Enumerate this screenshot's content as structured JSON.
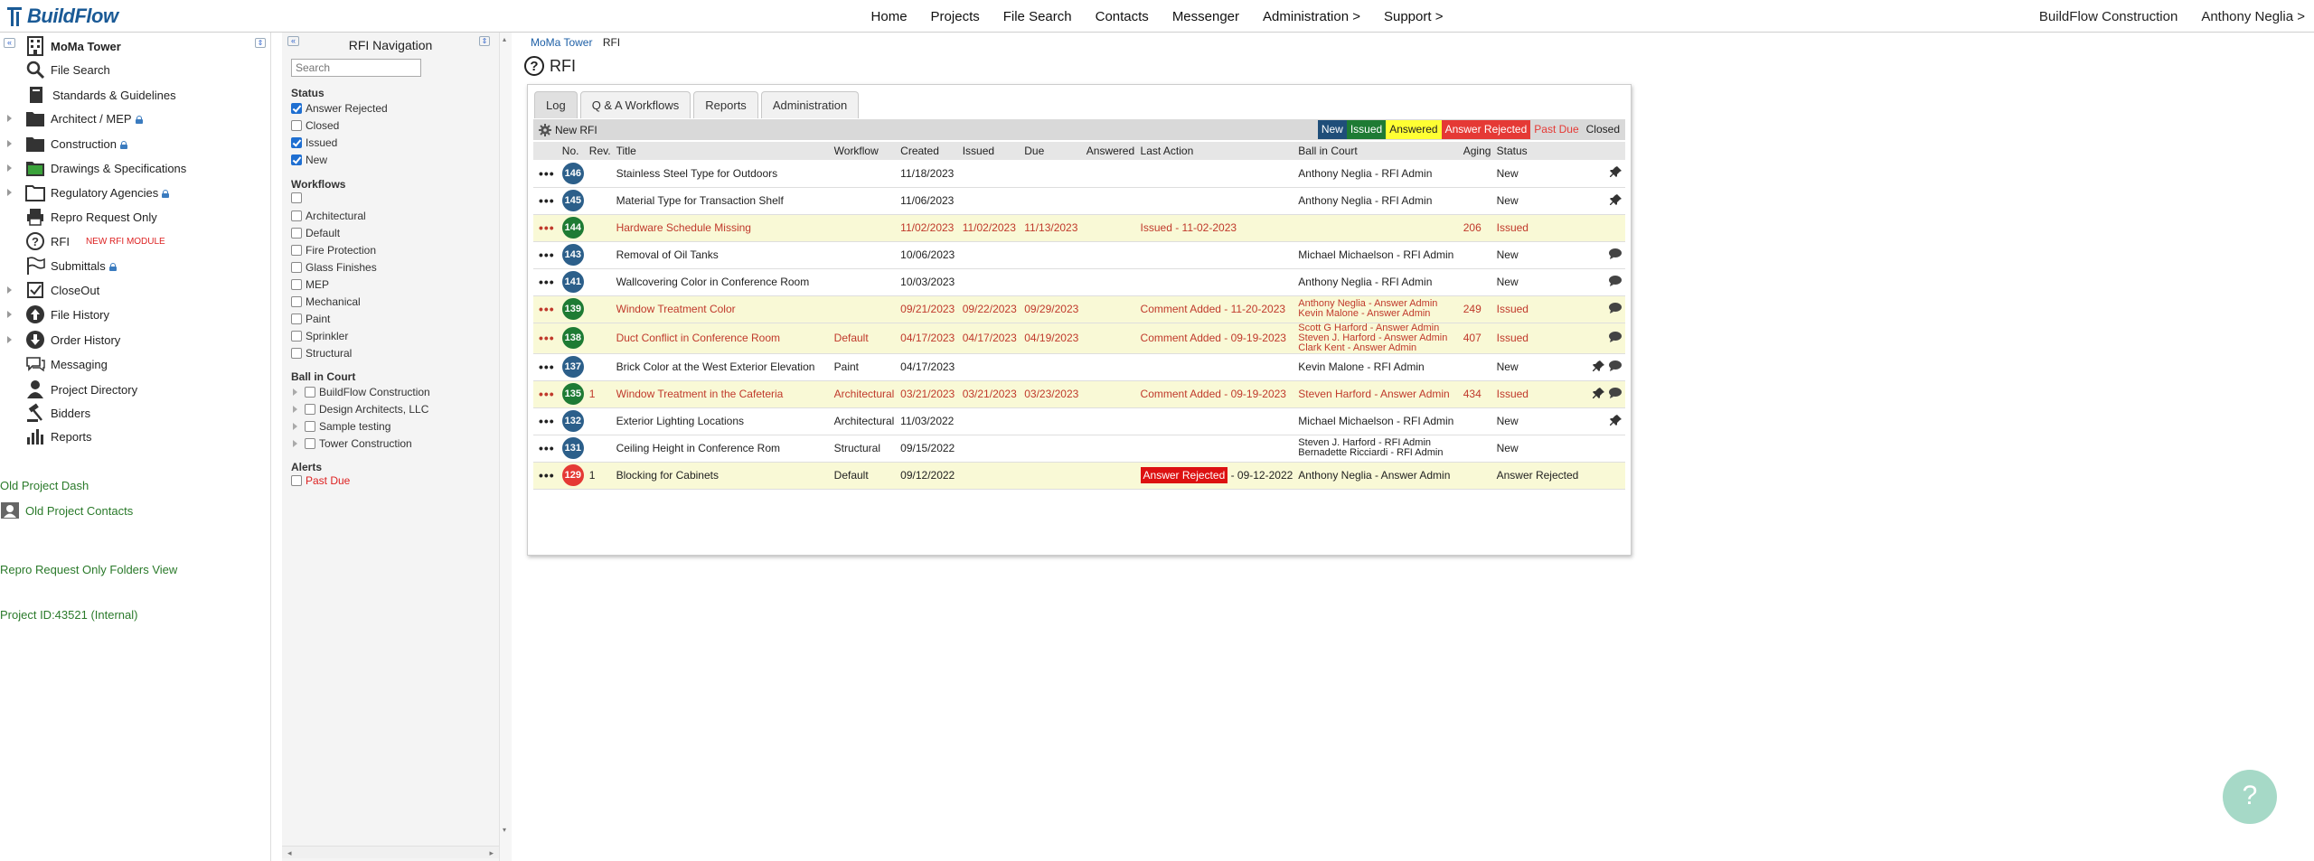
{
  "header": {
    "logo_text": "BuildFlow",
    "nav": [
      "Home",
      "Projects",
      "File Search",
      "Contacts",
      "Messenger",
      "Administration >",
      "Support >"
    ],
    "company": "BuildFlow Construction",
    "user": "Anthony Neglia >"
  },
  "project_tree": {
    "project_name": "MoMa Tower",
    "items": [
      {
        "label": "File Search",
        "icon": "magnifier-icon"
      },
      {
        "label": "Standards & Guidelines",
        "icon": "book-icon"
      },
      {
        "label": "Architect / MEP",
        "icon": "folder-icon",
        "locked": true,
        "expandable": true
      },
      {
        "label": "Construction",
        "icon": "folder-icon",
        "locked": true,
        "expandable": true
      },
      {
        "label": "Drawings & Specifications",
        "icon": "green-folder-icon",
        "expandable": true
      },
      {
        "label": "Regulatory Agencies",
        "icon": "folder-outline-icon",
        "locked": true,
        "expandable": true
      },
      {
        "label": "Repro Request Only",
        "icon": "printer-icon"
      },
      {
        "label": "RFI",
        "icon": "question-circle-icon",
        "note": "NEW RFI MODULE"
      },
      {
        "label": "Submittals",
        "icon": "flag-icon",
        "locked": true
      },
      {
        "label": "CloseOut",
        "icon": "checkbox-icon",
        "expandable": true
      },
      {
        "label": "File History",
        "icon": "upload-circle-icon",
        "expandable": true
      },
      {
        "label": "Order History",
        "icon": "download-circle-icon",
        "expandable": true
      },
      {
        "label": "Messaging",
        "icon": "chat-icon"
      },
      {
        "label": "Project Directory",
        "icon": "person-icon"
      },
      {
        "label": "Bidders",
        "icon": "hammer-icon"
      },
      {
        "label": "Reports",
        "icon": "bar-chart-icon"
      }
    ],
    "old_dash": "Old Project Dash",
    "old_contacts": "Old Project Contacts",
    "repro_view": "Repro Request Only Folders View",
    "project_id": "Project ID:43521 (Internal)"
  },
  "rfi_nav": {
    "title": "RFI Navigation",
    "search_placeholder": "Search",
    "status_head": "Status",
    "status": [
      {
        "label": "Answer Rejected",
        "checked": true
      },
      {
        "label": "Closed",
        "checked": false
      },
      {
        "label": "Issued",
        "checked": true
      },
      {
        "label": "New",
        "checked": true
      }
    ],
    "workflows_head": "Workflows",
    "workflows": [
      "",
      "Architectural",
      "Default",
      "Fire Protection",
      "Glass Finishes",
      "MEP",
      "Mechanical",
      "Paint",
      "Sprinkler",
      "Structural"
    ],
    "ball_head": "Ball in Court",
    "ball": [
      "BuildFlow Construction",
      "Design Architects, LLC",
      "Sample testing",
      "Tower Construction"
    ],
    "alerts_head": "Alerts",
    "alert_item": "Past Due"
  },
  "main": {
    "breadcrumb": [
      "MoMa Tower",
      "RFI"
    ],
    "title": "RFI",
    "tabs": [
      "Log",
      "Q & A Workflows",
      "Reports",
      "Administration"
    ],
    "new_rfi": "New RFI",
    "legend": [
      {
        "label": "New",
        "bg": "#1f4e79",
        "fg": "#ffffff"
      },
      {
        "label": "Issued",
        "bg": "#1e7b34",
        "fg": "#ffffff"
      },
      {
        "label": "Answered",
        "bg": "#ffff33",
        "fg": "#222222"
      },
      {
        "label": "Answer Rejected",
        "bg": "#e53935",
        "fg": "#ffffff"
      },
      {
        "label": "Past Due",
        "bg": "#d9d9d9",
        "fg": "#e53935"
      },
      {
        "label": "Closed",
        "bg": "#d9d9d9",
        "fg": "#222222"
      }
    ],
    "columns": [
      "",
      "No.",
      "Rev.",
      "Title",
      "Workflow",
      "Created",
      "Issued",
      "Due",
      "Answered",
      "Last Action",
      "Ball in Court",
      "Aging",
      "Status",
      ""
    ],
    "rows": [
      {
        "no": "146",
        "badge": "#2c5f8a",
        "rev": "",
        "title": "Stainless Steel Type for Outdoors",
        "workflow": "",
        "created": "11/18/2023",
        "issued": "",
        "due": "",
        "answered": "",
        "last_action": "",
        "ball": [
          "Anthony Neglia - RFI Admin"
        ],
        "aging": "",
        "status": "New",
        "pin": true,
        "chat": false,
        "alt": false,
        "red": false
      },
      {
        "no": "145",
        "badge": "#2c5f8a",
        "rev": "",
        "title": "Material Type for Transaction Shelf",
        "workflow": "",
        "created": "11/06/2023",
        "issued": "",
        "due": "",
        "answered": "",
        "last_action": "",
        "ball": [
          "Anthony Neglia - RFI Admin"
        ],
        "aging": "",
        "status": "New",
        "pin": true,
        "chat": false,
        "alt": false,
        "red": false
      },
      {
        "no": "144",
        "badge": "#1e7b34",
        "rev": "",
        "title": "Hardware Schedule Missing",
        "workflow": "",
        "created": "11/02/2023",
        "issued": "11/02/2023",
        "due": "11/13/2023",
        "answered": "",
        "last_action": "Issued - 11-02-2023",
        "ball": [
          ""
        ],
        "aging": "206",
        "status": "Issued",
        "pin": false,
        "chat": false,
        "alt": true,
        "red": true
      },
      {
        "no": "143",
        "badge": "#2c5f8a",
        "rev": "",
        "title": "Removal of Oil Tanks",
        "workflow": "",
        "created": "10/06/2023",
        "issued": "",
        "due": "",
        "answered": "",
        "last_action": "",
        "ball": [
          "Michael Michaelson - RFI Admin"
        ],
        "aging": "",
        "status": "New",
        "pin": false,
        "chat": true,
        "alt": false,
        "red": false
      },
      {
        "no": "141",
        "badge": "#2c5f8a",
        "rev": "",
        "title": "Wallcovering Color in Conference Room",
        "workflow": "",
        "created": "10/03/2023",
        "issued": "",
        "due": "",
        "answered": "",
        "last_action": "",
        "ball": [
          "Anthony Neglia - RFI Admin"
        ],
        "aging": "",
        "status": "New",
        "pin": false,
        "chat": true,
        "alt": false,
        "red": false
      },
      {
        "no": "139",
        "badge": "#1e7b34",
        "rev": "",
        "title": "Window Treatment Color",
        "workflow": "",
        "created": "09/21/2023",
        "issued": "09/22/2023",
        "due": "09/29/2023",
        "answered": "",
        "last_action": "Comment Added - 11-20-2023",
        "ball": [
          "Anthony Neglia - Answer Admin",
          "Kevin Malone - Answer Admin"
        ],
        "aging": "249",
        "status": "Issued",
        "pin": false,
        "chat": true,
        "alt": true,
        "red": true
      },
      {
        "no": "138",
        "badge": "#1e7b34",
        "rev": "",
        "title": "Duct Conflict in Conference Room",
        "workflow": "Default",
        "created": "04/17/2023",
        "issued": "04/17/2023",
        "due": "04/19/2023",
        "answered": "",
        "last_action": "Comment Added - 09-19-2023",
        "ball": [
          "Scott G Harford - Answer Admin",
          "Steven J. Harford - Answer Admin",
          "Clark Kent - Answer Admin"
        ],
        "aging": "407",
        "status": "Issued",
        "pin": false,
        "chat": true,
        "alt": true,
        "red": true
      },
      {
        "no": "137",
        "badge": "#2c5f8a",
        "rev": "",
        "title": "Brick Color at the West Exterior Elevation",
        "workflow": "Paint",
        "created": "04/17/2023",
        "issued": "",
        "due": "",
        "answered": "",
        "last_action": "",
        "ball": [
          "Kevin Malone - RFI Admin"
        ],
        "aging": "",
        "status": "New",
        "pin": true,
        "chat": true,
        "alt": false,
        "red": false
      },
      {
        "no": "135",
        "badge": "#1e7b34",
        "rev": "1",
        "title": "Window Treatment in the Cafeteria",
        "workflow": "Architectural",
        "created": "03/21/2023",
        "issued": "03/21/2023",
        "due": "03/23/2023",
        "answered": "",
        "last_action": "Comment Added - 09-19-2023",
        "ball": [
          "Steven Harford - Answer Admin"
        ],
        "aging": "434",
        "status": "Issued",
        "pin": true,
        "chat": true,
        "alt": true,
        "red": true
      },
      {
        "no": "132",
        "badge": "#2c5f8a",
        "rev": "",
        "title": "Exterior Lighting Locations",
        "workflow": "Architectural",
        "created": "11/03/2022",
        "issued": "",
        "due": "",
        "answered": "",
        "last_action": "",
        "ball": [
          "Michael Michaelson - RFI Admin"
        ],
        "aging": "",
        "status": "New",
        "pin": true,
        "chat": false,
        "alt": false,
        "red": false
      },
      {
        "no": "131",
        "badge": "#2c5f8a",
        "rev": "",
        "title": "Ceiling Height in Conference Rom",
        "workflow": "Structural",
        "created": "09/15/2022",
        "issued": "",
        "due": "",
        "answered": "",
        "last_action": "",
        "ball": [
          "Steven J. Harford - RFI Admin",
          "Bernadette Ricciardi - RFI Admin"
        ],
        "aging": "",
        "status": "New",
        "pin": false,
        "chat": false,
        "alt": false,
        "red": false
      },
      {
        "no": "129",
        "badge": "#e53935",
        "rev": "1",
        "title": "Blocking for Cabinets",
        "workflow": "Default",
        "created": "09/12/2022",
        "issued": "",
        "due": "",
        "answered": "",
        "last_action": "",
        "last_action_badge": "Answer Rejected",
        "last_action_date": " - 09-12-2022",
        "ball": [
          "Anthony Neglia - Answer Admin"
        ],
        "aging": "",
        "status": "Answer Rejected",
        "pin": false,
        "chat": false,
        "alt": true,
        "red": false
      }
    ]
  },
  "help_symbol": "?"
}
